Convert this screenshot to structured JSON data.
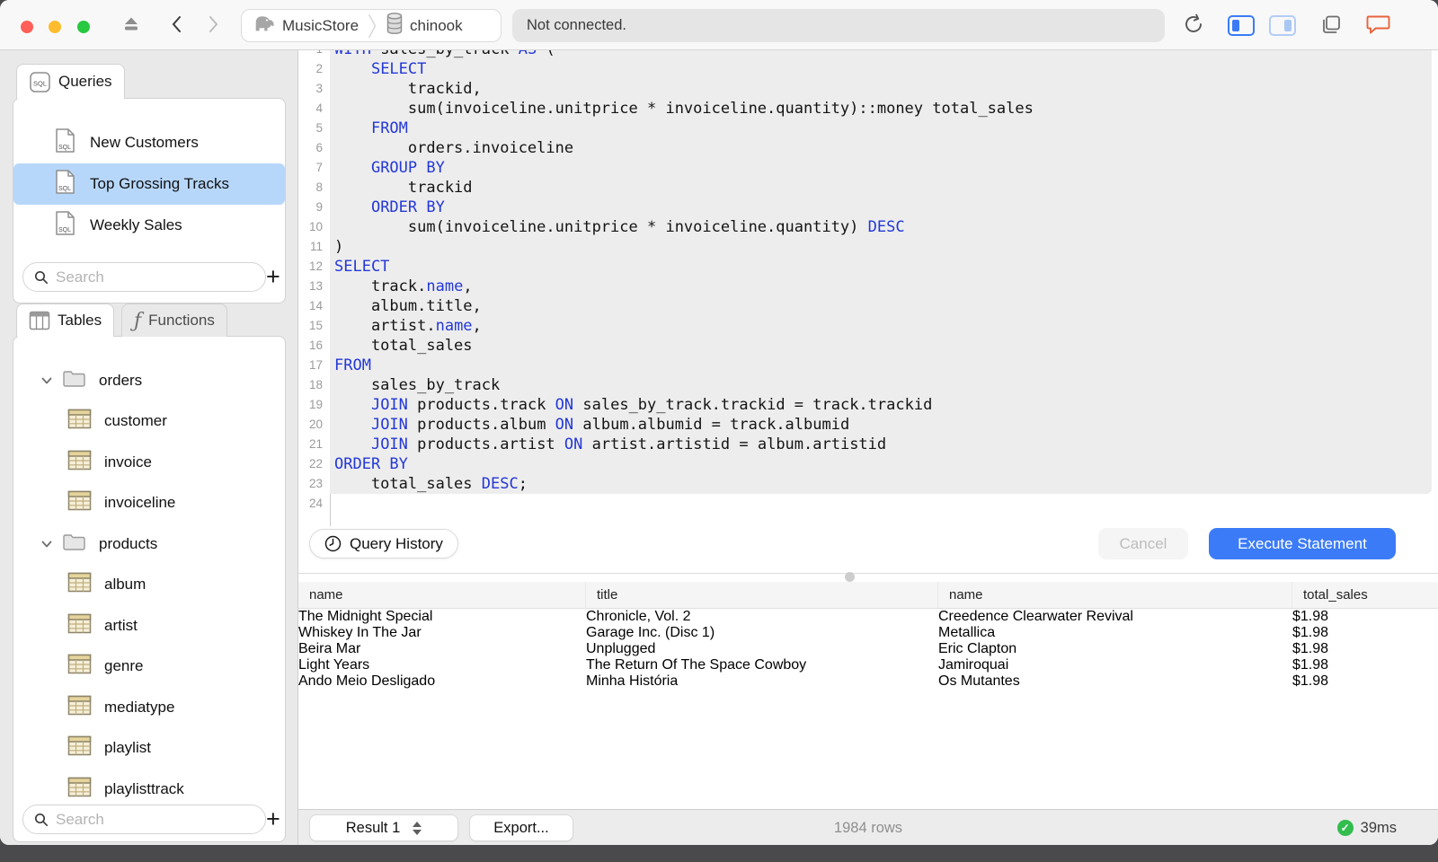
{
  "titlebar": {
    "breadcrumb": {
      "server": "MusicStore",
      "database": "chinook"
    },
    "status": "Not connected.",
    "icons": [
      "eject-icon",
      "back-icon",
      "forward-icon",
      "elephant-icon",
      "database-icon",
      "refresh-icon",
      "sidebar-left-toggle",
      "sidebar-right-toggle",
      "windows-icon",
      "feedback-bubble-icon"
    ]
  },
  "sidebar": {
    "queries": {
      "tab_label": "Queries",
      "items": [
        {
          "label": "New Customers",
          "selected": false
        },
        {
          "label": "Top Grossing Tracks",
          "selected": true
        },
        {
          "label": "Weekly Sales",
          "selected": false
        }
      ],
      "search_placeholder": "Search"
    },
    "schema": {
      "tables_tab": "Tables",
      "functions_tab": "Functions",
      "tree": [
        {
          "label": "orders",
          "type": "folder",
          "expanded": true
        },
        {
          "label": "customer",
          "type": "table"
        },
        {
          "label": "invoice",
          "type": "table"
        },
        {
          "label": "invoiceline",
          "type": "table"
        },
        {
          "label": "products",
          "type": "folder",
          "expanded": true
        },
        {
          "label": "album",
          "type": "table"
        },
        {
          "label": "artist",
          "type": "table"
        },
        {
          "label": "genre",
          "type": "table"
        },
        {
          "label": "mediatype",
          "type": "table"
        },
        {
          "label": "playlist",
          "type": "table"
        },
        {
          "label": "playlisttrack",
          "type": "table"
        }
      ],
      "search_placeholder": "Search"
    }
  },
  "editor": {
    "query_history_label": "Query History",
    "cancel_label": "Cancel",
    "execute_label": "Execute Statement",
    "highlight_lines": 23,
    "lines": [
      [
        [
          "WITH",
          1
        ],
        [
          " sales_by_track ",
          0
        ],
        [
          "AS",
          1
        ],
        [
          " (",
          0
        ]
      ],
      [
        [
          "    ",
          0
        ],
        [
          "SELECT",
          1
        ]
      ],
      [
        [
          "        trackid,",
          0
        ]
      ],
      [
        [
          "        sum(invoiceline.unitprice * invoiceline.quantity)::money total_sales",
          0
        ]
      ],
      [
        [
          "    ",
          0
        ],
        [
          "FROM",
          1
        ]
      ],
      [
        [
          "        orders.invoiceline",
          0
        ]
      ],
      [
        [
          "    ",
          0
        ],
        [
          "GROUP BY",
          1
        ]
      ],
      [
        [
          "        trackid",
          0
        ]
      ],
      [
        [
          "    ",
          0
        ],
        [
          "ORDER BY",
          1
        ]
      ],
      [
        [
          "        sum(invoiceline.unitprice * invoiceline.quantity) ",
          0
        ],
        [
          "DESC",
          1
        ]
      ],
      [
        [
          ")",
          0
        ]
      ],
      [
        [
          "SELECT",
          1
        ]
      ],
      [
        [
          "    track.",
          0
        ],
        [
          "name",
          1
        ],
        [
          ",",
          0
        ]
      ],
      [
        [
          "    album.title,",
          0
        ]
      ],
      [
        [
          "    artist.",
          0
        ],
        [
          "name",
          1
        ],
        [
          ",",
          0
        ]
      ],
      [
        [
          "    total_sales",
          0
        ]
      ],
      [
        [
          "FROM",
          1
        ]
      ],
      [
        [
          "    sales_by_track",
          0
        ]
      ],
      [
        [
          "    ",
          0
        ],
        [
          "JOIN",
          1
        ],
        [
          " products.track ",
          0
        ],
        [
          "ON",
          1
        ],
        [
          " sales_by_track.trackid = track.trackid",
          0
        ]
      ],
      [
        [
          "    ",
          0
        ],
        [
          "JOIN",
          1
        ],
        [
          " products.album ",
          0
        ],
        [
          "ON",
          1
        ],
        [
          " album.albumid = track.albumid",
          0
        ]
      ],
      [
        [
          "    ",
          0
        ],
        [
          "JOIN",
          1
        ],
        [
          " products.artist ",
          0
        ],
        [
          "ON",
          1
        ],
        [
          " artist.artistid = album.artistid",
          0
        ]
      ],
      [
        [
          "ORDER BY",
          1
        ]
      ],
      [
        [
          "    total_sales ",
          0
        ],
        [
          "DESC",
          1
        ],
        [
          ";",
          0
        ]
      ],
      [
        [
          "",
          0
        ]
      ]
    ]
  },
  "results": {
    "columns": [
      "name",
      "title",
      "name",
      "total_sales"
    ],
    "rows": [
      [
        "The Midnight Special",
        "Chronicle, Vol. 2",
        "Creedence Clearwater Revival",
        "$1.98"
      ],
      [
        "Whiskey In The Jar",
        "Garage Inc. (Disc 1)",
        "Metallica",
        "$1.98"
      ],
      [
        "Beira Mar",
        "Unplugged",
        "Eric Clapton",
        "$1.98"
      ],
      [
        "Light Years",
        "The Return Of The Space Cowboy",
        "Jamiroquai",
        "$1.98"
      ],
      [
        "Ando Meio Desligado",
        "Minha História",
        "Os Mutantes",
        "$1.98"
      ]
    ]
  },
  "statusbar": {
    "result_selector": "Result 1",
    "export_label": "Export...",
    "row_count": "1984 rows",
    "duration": "39ms"
  },
  "colors": {
    "accent": "#3b7bf7",
    "selection": "#b7d7fa",
    "keyword": "#2438d6",
    "success": "#32bd4f",
    "feedback_bubble": "#e8643c"
  }
}
